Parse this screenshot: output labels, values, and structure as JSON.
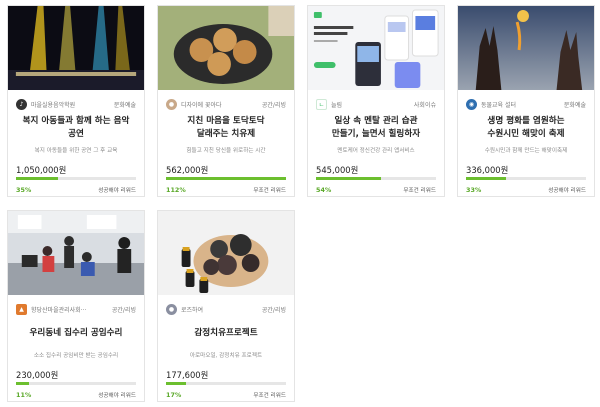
{
  "cards": [
    {
      "org": "마을실용음악학원",
      "category": "문화예술",
      "title_line1": "복지 아동들과 함께 하는 음악",
      "title_line2": "공연",
      "subtitle": "복지 아동들을 위한 공연 그 후 교육",
      "amount": "1,050,000원",
      "percent": "35%",
      "progress": 0.35,
      "reward": "성공해야 리워드",
      "thumb": "concert-stage-image",
      "icon_color": "#333333"
    },
    {
      "org": "디자이에 꽃아다",
      "category": "공간/리빙",
      "title_line1": "지친 마음을 토닥토닥",
      "title_line2": "달래주는 치유제",
      "subtitle": "힘들고 지친 당신을 위로하는 시간",
      "amount": "562,000원",
      "percent": "112%",
      "progress": 1.0,
      "reward": "무조건 리워드",
      "thumb": "cookies-plate-image",
      "icon_color": "#c9a98a"
    },
    {
      "org": "늘림",
      "category": "사회이슈",
      "title_line1": "일상 속 멘탈 관리 습관",
      "title_line2": "만들기, 늘면서 힐링하자",
      "subtitle": "멘토케어 정신건강 관리 앱서비스",
      "amount": "545,000원",
      "percent": "54%",
      "progress": 0.54,
      "reward": "무조건 리워드",
      "thumb": "mobile-app-screens-image",
      "icon_color": "#3fbf6a"
    },
    {
      "org": "동물교육 설터",
      "category": "문화예술",
      "title_line1": "생명 평화를 염원하는",
      "title_line2": "수원시민 해맞이 축제",
      "subtitle": "수원시민과 함께 만드는 해맞이축제",
      "amount": "336,000원",
      "percent": "33%",
      "progress": 0.33,
      "reward": "성공해야 리워드",
      "thumb": "sunrise-hands-image",
      "icon_color": "#2f6fb0"
    },
    {
      "org": "향당산마을관리사회···",
      "category": "공간/리빙",
      "title_line1": "우리동네 집수리 공임수리",
      "title_line2": "",
      "subtitle": "소소 집수리 공임비만 받는 공임수리",
      "amount": "230,000원",
      "percent": "11%",
      "progress": 0.11,
      "reward": "성공해야 리워드",
      "thumb": "classroom-image",
      "icon_color": "#e07a2e"
    },
    {
      "org": "로즈하여",
      "category": "공간/리빙",
      "title_line1": "감정치유프로젝트",
      "title_line2": "",
      "subtitle": "아로마오일, 감정치유 프로젝트",
      "amount": "177,600원",
      "percent": "17%",
      "progress": 0.17,
      "reward": "무조건 리워드",
      "thumb": "aroma-products-image",
      "icon_color": "#8a8fa0"
    }
  ]
}
